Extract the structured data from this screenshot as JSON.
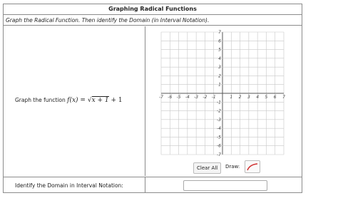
{
  "header": {
    "title": "Graphing Radical Functions",
    "instructions": "Graph the Radical Function. Then identify the Domain (in Interval Notation)."
  },
  "question": {
    "prompt": "Graph the function",
    "function_lhs": "f(x) = ",
    "radicand": "x + 1",
    "function_tail": " + 1"
  },
  "grid": {
    "x_ticks": [
      "-7",
      "-6",
      "-5",
      "-4",
      "-3",
      "-2",
      "-1",
      "1",
      "2",
      "3",
      "4",
      "5",
      "6",
      "7"
    ],
    "y_ticks": [
      "7",
      "6",
      "5",
      "4",
      "3",
      "2",
      "1",
      "-1",
      "-2",
      "-3",
      "-4",
      "-5",
      "-6",
      "-7"
    ],
    "x_range": [
      -7,
      7
    ],
    "y_range": [
      -7,
      7
    ],
    "grid_color": "#c8c8c8",
    "axis_color": "#555555"
  },
  "toolbar": {
    "clear_label": "Clear All",
    "draw_label": "Draw:",
    "draw_tool_icon": "curve-icon",
    "draw_tool_color": "#d03030"
  },
  "domain": {
    "label": "Identify the Domain in Interval Notation:",
    "value": "",
    "placeholder": ""
  }
}
